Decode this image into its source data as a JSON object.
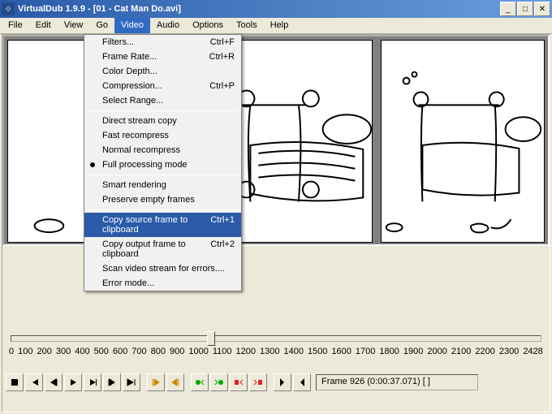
{
  "title": "VirtualDub 1.9.9 - [01 - Cat Man Do.avi]",
  "menubar": [
    "File",
    "Edit",
    "View",
    "Go",
    "Video",
    "Audio",
    "Options",
    "Tools",
    "Help"
  ],
  "open_menu_index": 4,
  "dropdown": {
    "groups": [
      [
        {
          "label": "Filters...",
          "shortcut": "Ctrl+F"
        },
        {
          "label": "Frame Rate...",
          "shortcut": "Ctrl+R"
        },
        {
          "label": "Color Depth..."
        },
        {
          "label": "Compression...",
          "shortcut": "Ctrl+P"
        },
        {
          "label": "Select Range..."
        }
      ],
      [
        {
          "label": "Direct stream copy"
        },
        {
          "label": "Fast recompress"
        },
        {
          "label": "Normal recompress"
        },
        {
          "label": "Full processing mode",
          "radio": true
        }
      ],
      [
        {
          "label": "Smart rendering"
        },
        {
          "label": "Preserve empty frames"
        }
      ],
      [
        {
          "label": "Copy source frame to clipboard",
          "shortcut": "Ctrl+1",
          "highlight": true
        },
        {
          "label": "Copy output frame to clipboard",
          "shortcut": "Ctrl+2"
        },
        {
          "label": "Scan video stream for errors...."
        },
        {
          "label": "Error mode..."
        }
      ]
    ]
  },
  "timeline": {
    "ticks": [
      "0",
      "100",
      "200",
      "300",
      "400",
      "500",
      "600",
      "700",
      "800",
      "900",
      "1000",
      "1100",
      "1200",
      "1300",
      "1400",
      "1500",
      "1600",
      "1700",
      "1800",
      "1900",
      "2000",
      "2100",
      "2200",
      "2300",
      "2428"
    ],
    "thumb_pos_pct": 37
  },
  "status": "Frame 926 (0:00:37.071) [ ]",
  "toolbar_icons": [
    "stop-icon",
    "rewind-start-icon",
    "step-back-icon",
    "play-in-icon",
    "play-out-icon",
    "step-fwd-icon",
    "fast-end-icon",
    "sep",
    "range-start-icon",
    "range-end-icon",
    "sep",
    "key-prev-icon",
    "key-next-icon",
    "scene-prev-icon",
    "scene-next-icon",
    "sep",
    "mark-in-icon",
    "mark-out-icon"
  ]
}
